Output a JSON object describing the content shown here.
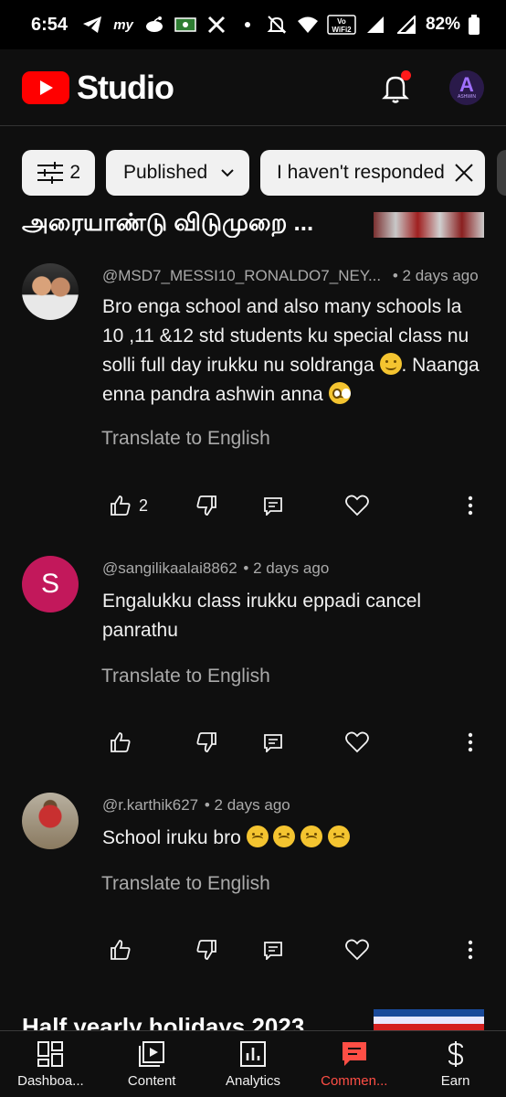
{
  "status_bar": {
    "time": "6:54",
    "notification_icons": [
      "telegram-icon",
      "myjio-icon",
      "reddit-icon",
      "money-icon",
      "x-icon",
      "dot-icon"
    ],
    "volte_label": "Vo\nWiFi 2",
    "battery": "82%"
  },
  "header": {
    "logo_text": "Studio",
    "notification_dot_color": "#ff1a1a",
    "avatar_letter": "A",
    "avatar_caption": "ASHWIN"
  },
  "filters": {
    "filter_count": "2",
    "published_label": "Published",
    "responded_label": "I haven't responded"
  },
  "video": {
    "title": "அரையாண்டு விடுமுறை ..."
  },
  "comments": [
    {
      "author": "@MSD7_MESSI10_RONALDO7_NEY...",
      "time": "• 2 days ago",
      "text_parts": [
        "Bro enga school and also many schools la 10 ,11 &12  std students ku special class nu solli full day irukku nu soldranga ",
        ". Naanga enna pandra ashwin anna "
      ],
      "translate": "Translate to English",
      "likes": "2"
    },
    {
      "author": "@sangilikaalai8862",
      "avatar_letter": "S",
      "time": "• 2 days ago",
      "text": "Engalukku class irukku eppadi cancel panrathu",
      "translate": "Translate to English",
      "likes": ""
    },
    {
      "author": "@r.karthik627",
      "time": "• 2 days ago",
      "text": "School iruku bro ",
      "translate": "Translate to English",
      "likes": ""
    }
  ],
  "next_video": {
    "title": "Half yearly holidays 2023"
  },
  "bottom_nav": [
    {
      "label": "Dashboa...",
      "icon": "dashboard-icon"
    },
    {
      "label": "Content",
      "icon": "content-icon"
    },
    {
      "label": "Analytics",
      "icon": "analytics-icon"
    },
    {
      "label": "Commen...",
      "icon": "comments-icon",
      "active": true
    },
    {
      "label": "Earn",
      "icon": "earn-icon"
    }
  ],
  "colors": {
    "background": "#0f0f0f",
    "brand_red": "#ff0000",
    "active_tab": "#ff4e45",
    "secondary_text": "#aaaaaa"
  }
}
